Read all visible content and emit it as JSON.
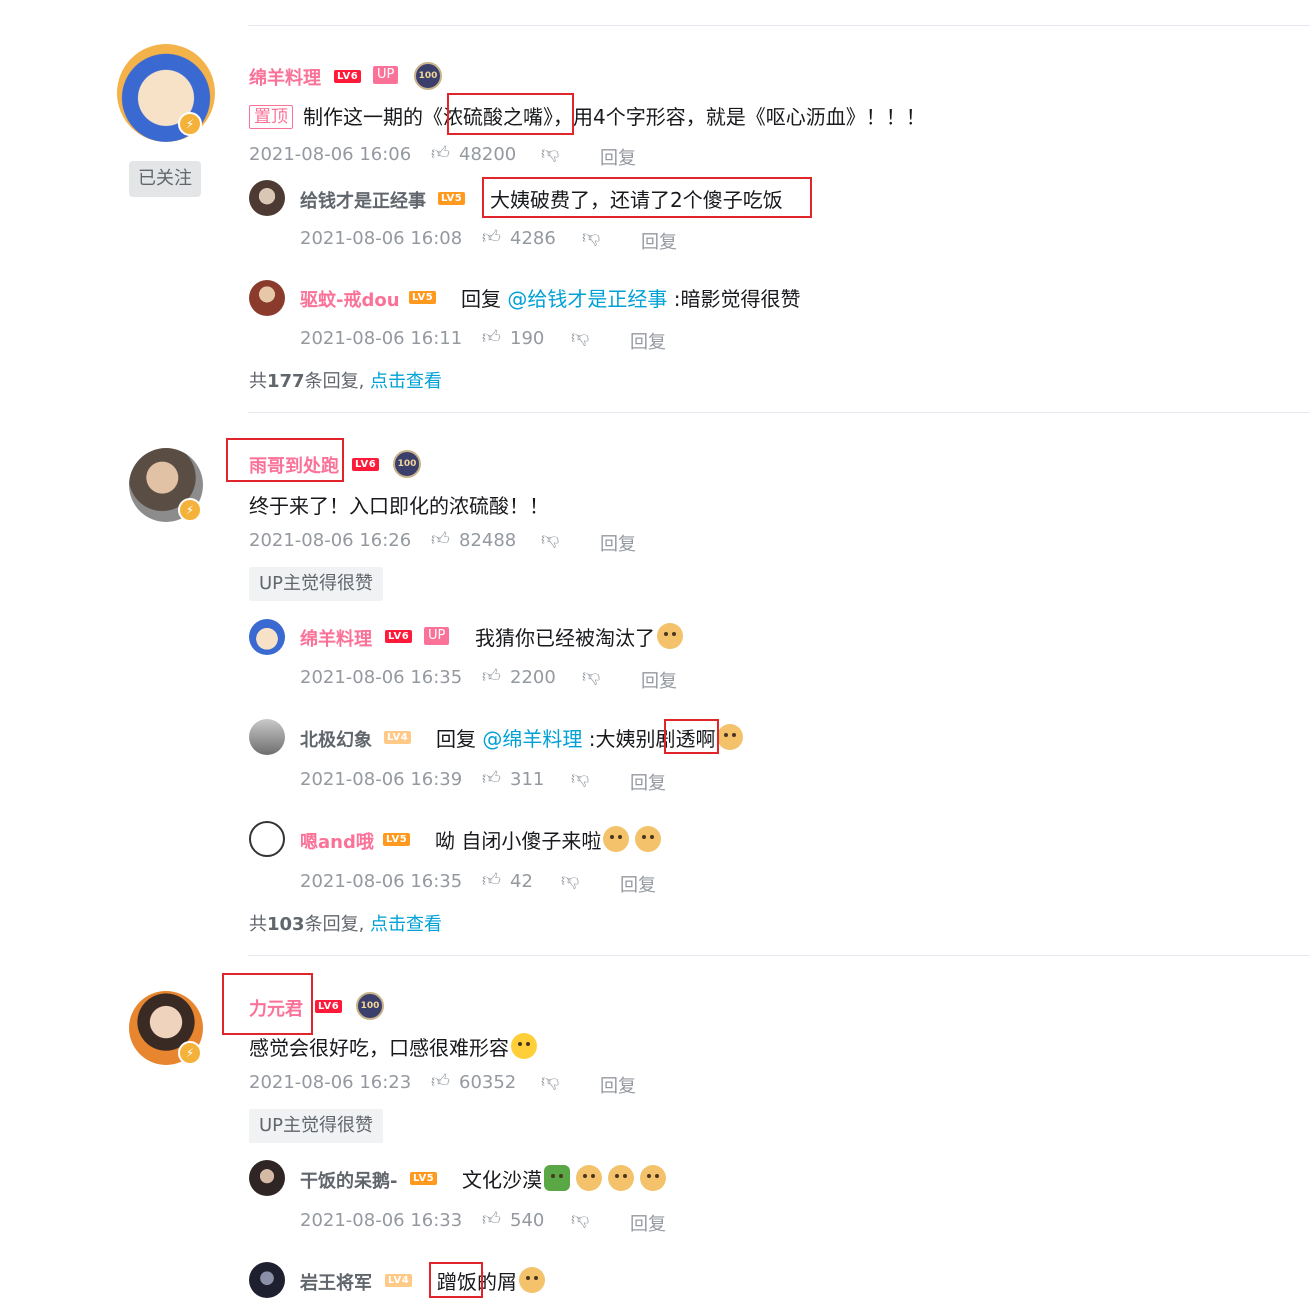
{
  "comments": [
    {
      "name": "绵羊料理",
      "level": "LV6",
      "up_tag": "UP",
      "medal": "100",
      "pinned": "置顶",
      "text_before": "制作这一期的《",
      "text_highlight": "浓硫酸之嘴",
      "text_after": "》，用4个字形容，就是《呕心沥血》！！！",
      "time": "2021-08-06 16:06",
      "likes": "48200",
      "reply": "回复",
      "follow": "已关注",
      "replies": [
        {
          "name": "给钱才是正经事",
          "level": "LV5",
          "text": "大姨破费了，还请了2个傻子吃饭",
          "time": "2021-08-06 16:08",
          "likes": "4286",
          "reply": "回复"
        },
        {
          "name": "驱蚊-戒dou",
          "level": "LV5",
          "reply_prefix": "回复 ",
          "at": "@给钱才是正经事",
          "text": " :暗影觉得很赞",
          "time": "2021-08-06 16:11",
          "likes": "190",
          "reply": "回复"
        }
      ],
      "more_prefix": "共",
      "more_count": "177",
      "more_suffix": "条回复, ",
      "more_link": "点击查看"
    },
    {
      "name": "雨哥到处跑",
      "level": "LV6",
      "medal": "100",
      "text": "终于来了！入口即化的浓硫酸！！",
      "time": "2021-08-06 16:26",
      "likes": "82488",
      "reply": "回复",
      "up_liked": "UP主觉得很赞",
      "replies": [
        {
          "name": "绵羊料理",
          "level": "LV6",
          "up_tag": "UP",
          "text": "我猜你已经被淘汰了",
          "time": "2021-08-06 16:35",
          "likes": "2200",
          "reply": "回复"
        },
        {
          "name": "北极幻象",
          "level": "LV4",
          "reply_prefix": "回复 ",
          "at": "@绵羊料理",
          "text": " :大姨别剧透啊",
          "time": "2021-08-06 16:39",
          "likes": "311",
          "reply": "回复"
        },
        {
          "name": "嗯and哦",
          "level": "LV5",
          "text": "呦 自闭小傻子来啦",
          "time": "2021-08-06 16:35",
          "likes": "42",
          "reply": "回复"
        }
      ],
      "more_prefix": "共",
      "more_count": "103",
      "more_suffix": "条回复, ",
      "more_link": "点击查看"
    },
    {
      "name": "力元君",
      "level": "LV6",
      "medal": "100",
      "text": "感觉会很好吃，口感很难形容",
      "time": "2021-08-06 16:23",
      "likes": "60352",
      "reply": "回复",
      "up_liked": "UP主觉得很赞",
      "replies": [
        {
          "name": "干饭的呆鹅-",
          "level": "LV5",
          "text": "文化沙漠",
          "time": "2021-08-06 16:33",
          "likes": "540",
          "reply": "回复"
        },
        {
          "name": "岩王将军",
          "level": "LV4",
          "text": "蹭饭的屑"
        }
      ]
    }
  ],
  "colors": {
    "name_pink": "#fb7299",
    "link_blue": "#00a1d6",
    "meta_gray": "#9499a0",
    "highlight_red": "#e0262a"
  },
  "icons": {
    "like": "thumbs-up-icon",
    "dislike": "thumbs-down-icon",
    "verify": "lightning-icon"
  }
}
